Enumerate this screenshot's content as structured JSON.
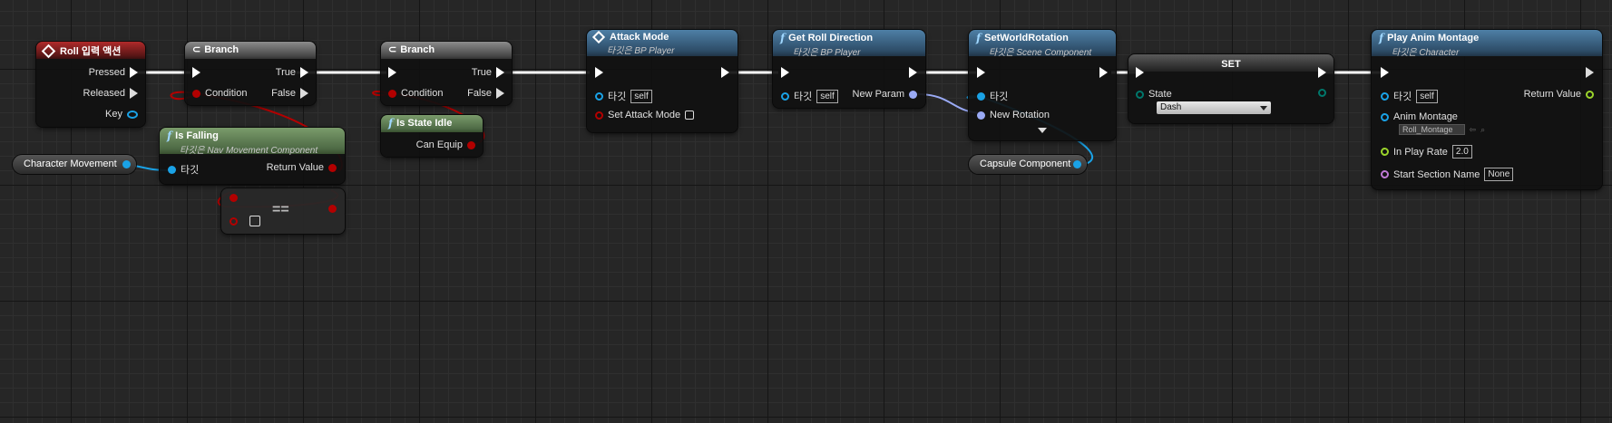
{
  "nodes": {
    "roll_input": {
      "title": "Roll 입력 액션",
      "pressed": "Pressed",
      "released": "Released",
      "key": "Key"
    },
    "branch1": {
      "title": "Branch",
      "condition": "Condition",
      "true_label": "True",
      "false_label": "False"
    },
    "branch2": {
      "title": "Branch",
      "condition": "Condition",
      "true_label": "True",
      "false_label": "False"
    },
    "attack_mode": {
      "title": "Attack Mode",
      "subtitle": "타깃은 BP Player",
      "target": "타깃",
      "target_value": "self",
      "set_attack_mode": "Set Attack Mode"
    },
    "get_roll_direction": {
      "title": "Get Roll Direction",
      "subtitle": "타깃은 BP Player",
      "target": "타깃",
      "target_value": "self",
      "new_param": "New Param"
    },
    "set_world_rotation": {
      "title": "SetWorldRotation",
      "subtitle": "타깃은 Scene Component",
      "target": "타깃",
      "new_rotation": "New Rotation"
    },
    "set_node": {
      "title": "SET",
      "state": "State",
      "state_value": "Dash"
    },
    "play_anim_montage": {
      "title": "Play Anim Montage",
      "subtitle": "타깃은 Character",
      "target": "타깃",
      "target_value": "self",
      "return_value": "Return Value",
      "anim_montage": "Anim Montage",
      "anim_montage_value": "Roll_Montage",
      "in_play_rate": "In Play Rate",
      "in_play_rate_value": "2.0",
      "start_section_name": "Start Section Name",
      "start_section_value": "None"
    },
    "is_falling": {
      "title": "Is Falling",
      "subtitle": "타깃은 Nav Movement Component",
      "target": "타깃",
      "return_value": "Return Value"
    },
    "is_state_idle": {
      "title": "Is State Idle",
      "can_equip": "Can Equip"
    },
    "equals": {
      "op": "=="
    },
    "character_movement": {
      "label": "Character Movement"
    },
    "capsule_component": {
      "label": "Capsule Component"
    }
  },
  "colors": {
    "exec": "#ffffff",
    "bool": "#b30000",
    "object": "#1aa2e6",
    "rotator": "#9aaaf5",
    "byte_enum": "#00776b",
    "float": "#9bd42b",
    "name": "#c07ad6",
    "event_header": "#b02a2a",
    "function_header": "#4e7fa6",
    "pure_header": "#7a9b6b"
  },
  "icons": {
    "event": "diamond-icon",
    "branch": "branch-icon",
    "function": "function-icon",
    "dropdown": "chevron-down-icon"
  }
}
